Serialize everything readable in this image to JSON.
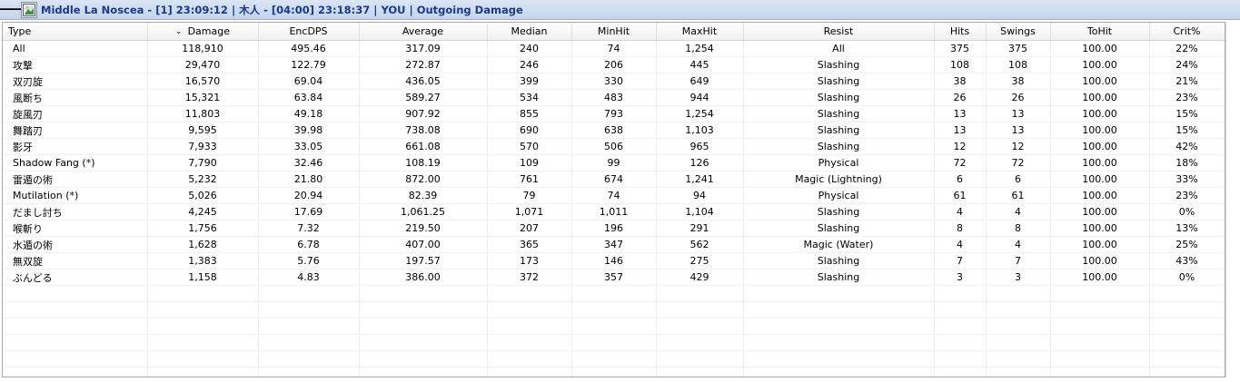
{
  "title": {
    "text": "Middle La Noscea - [1] 23:09:12 | 木人 - [04:00] 23:18:37 | YOU | Outgoing Damage"
  },
  "columns": [
    "Type",
    "Damage",
    "EncDPS",
    "Average",
    "Median",
    "MinHit",
    "MaxHit",
    "Resist",
    "Hits",
    "Swings",
    "ToHit",
    "Crit%"
  ],
  "rows": [
    [
      "All",
      "118,910",
      "495.46",
      "317.09",
      "240",
      "74",
      "1,254",
      "All",
      "375",
      "375",
      "100.00",
      "22%"
    ],
    [
      "攻撃",
      "29,470",
      "122.79",
      "272.87",
      "246",
      "206",
      "445",
      "Slashing",
      "108",
      "108",
      "100.00",
      "24%"
    ],
    [
      "双刃旋",
      "16,570",
      "69.04",
      "436.05",
      "399",
      "330",
      "649",
      "Slashing",
      "38",
      "38",
      "100.00",
      "21%"
    ],
    [
      "風断ち",
      "15,321",
      "63.84",
      "589.27",
      "534",
      "483",
      "944",
      "Slashing",
      "26",
      "26",
      "100.00",
      "23%"
    ],
    [
      "旋風刃",
      "11,803",
      "49.18",
      "907.92",
      "855",
      "793",
      "1,254",
      "Slashing",
      "13",
      "13",
      "100.00",
      "15%"
    ],
    [
      "舞踏刃",
      "9,595",
      "39.98",
      "738.08",
      "690",
      "638",
      "1,103",
      "Slashing",
      "13",
      "13",
      "100.00",
      "15%"
    ],
    [
      "影牙",
      "7,933",
      "33.05",
      "661.08",
      "570",
      "506",
      "965",
      "Slashing",
      "12",
      "12",
      "100.00",
      "42%"
    ],
    [
      "Shadow Fang (*)",
      "7,790",
      "32.46",
      "108.19",
      "109",
      "99",
      "126",
      "Physical",
      "72",
      "72",
      "100.00",
      "18%"
    ],
    [
      "雷遁の術",
      "5,232",
      "21.80",
      "872.00",
      "761",
      "674",
      "1,241",
      "Magic (Lightning)",
      "6",
      "6",
      "100.00",
      "33%"
    ],
    [
      "Mutilation (*)",
      "5,026",
      "20.94",
      "82.39",
      "79",
      "74",
      "94",
      "Physical",
      "61",
      "61",
      "100.00",
      "23%"
    ],
    [
      "だまし討ち",
      "4,245",
      "17.69",
      "1,061.25",
      "1,071",
      "1,011",
      "1,104",
      "Slashing",
      "4",
      "4",
      "100.00",
      "0%"
    ],
    [
      "喉斬り",
      "1,756",
      "7.32",
      "219.50",
      "207",
      "196",
      "291",
      "Slashing",
      "8",
      "8",
      "100.00",
      "13%"
    ],
    [
      "水遁の術",
      "1,628",
      "6.78",
      "407.00",
      "365",
      "347",
      "562",
      "Magic (Water)",
      "4",
      "4",
      "100.00",
      "25%"
    ],
    [
      "無双旋",
      "1,383",
      "5.76",
      "197.57",
      "173",
      "146",
      "275",
      "Slashing",
      "7",
      "7",
      "100.00",
      "43%"
    ],
    [
      "ぶんどる",
      "1,158",
      "4.83",
      "386.00",
      "372",
      "357",
      "429",
      "Slashing",
      "3",
      "3",
      "100.00",
      "0%"
    ]
  ],
  "sort_icon": "chevron-down-icon",
  "empty_rows": 6
}
